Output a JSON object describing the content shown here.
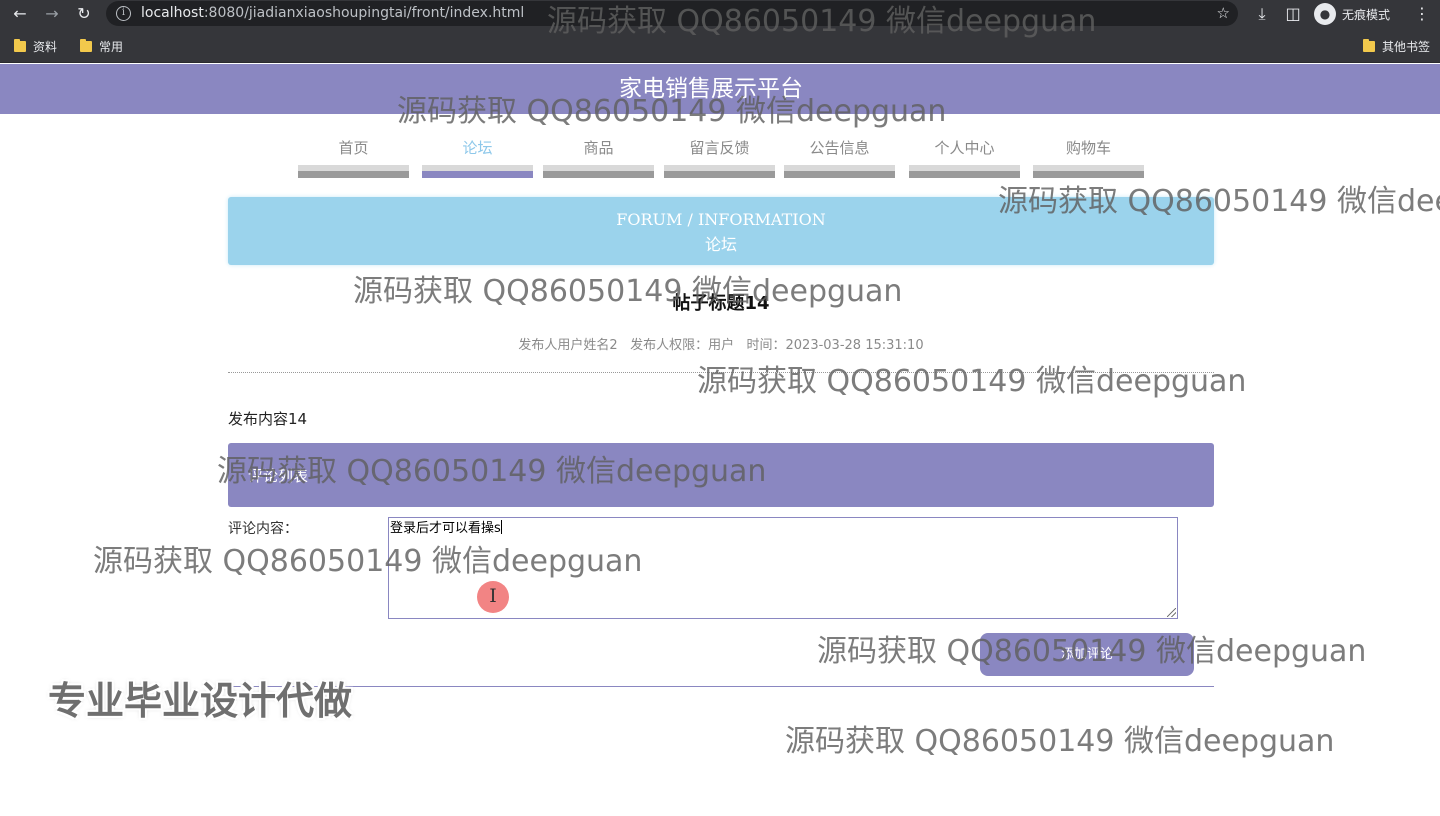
{
  "browser": {
    "url_host": "localhost",
    "url_path": ":8080/jiadianxiaoshoupingtai/front/index.html",
    "incognito_label": "无痕模式",
    "bookmarks": [
      "资料",
      "常用"
    ],
    "other_bookmarks": "其他书签",
    "icons": [
      "back-arrow-icon",
      "forward-arrow-icon",
      "reload-icon",
      "info-icon",
      "star-icon",
      "download-icon",
      "side-panel-icon",
      "incognito-icon",
      "more-vert-icon",
      "folder-icon"
    ]
  },
  "site": {
    "title": "家电销售展示平台",
    "accent_color": "#8a87c1",
    "banner_color": "#9bd3ec"
  },
  "nav": {
    "items": [
      {
        "label": "首页"
      },
      {
        "label": "论坛",
        "active": true
      },
      {
        "label": "商品"
      },
      {
        "label": "留言反馈"
      },
      {
        "label": "公告信息"
      },
      {
        "label": "个人中心"
      },
      {
        "label": "购物车"
      }
    ]
  },
  "banner": {
    "english": "FORUM / INFORMATION",
    "chinese": "论坛"
  },
  "post": {
    "title": "帖子标题14",
    "author": "发布人用户姓名2",
    "role": "发布人权限：用户",
    "time": "时间：2023-03-28 15:31:10",
    "body": "发布内容14"
  },
  "comments": {
    "section_label": "评论列表",
    "input_label": "评论内容：",
    "input_value": "登录后才可以看操s",
    "add_button": "添加评论"
  },
  "overlays": {
    "watermark": "源码获取 QQ86050149 微信deepguan",
    "watermark_cut": "源码获取 QQ86050149 微信dee",
    "promo": "专业毕业设计代做"
  }
}
